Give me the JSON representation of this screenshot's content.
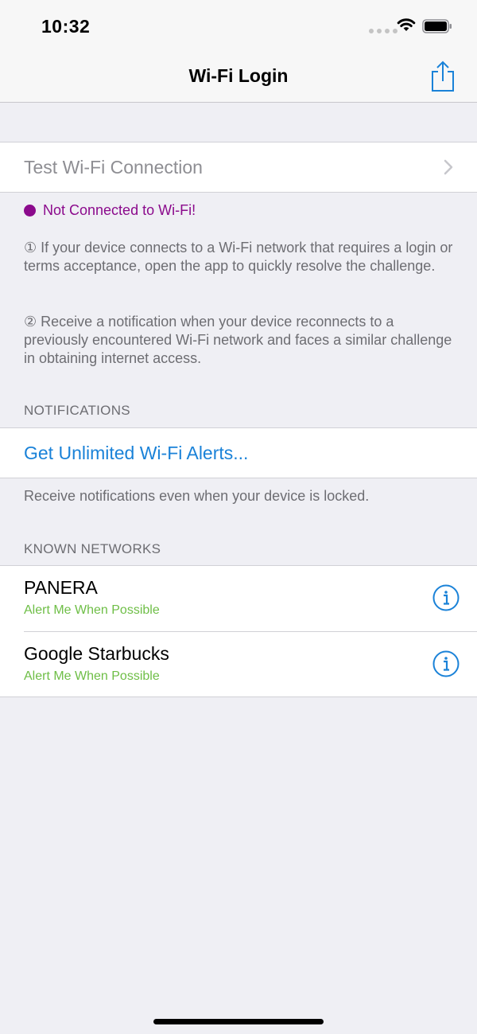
{
  "status_bar": {
    "time": "10:32"
  },
  "nav": {
    "title": "Wi-Fi Login"
  },
  "test_connection": {
    "label": "Test Wi-Fi Connection"
  },
  "connection_status": {
    "text": "Not Connected to Wi-Fi!",
    "color": "#8b0a8c"
  },
  "info": {
    "para1": "① If your device connects to a Wi-Fi network that requires a login or terms acceptance, open the app to quickly resolve the challenge.",
    "para2": "② Receive a notification when your device reconnects to a previously encountered Wi-Fi network and faces a similar challenge in obtaining internet access."
  },
  "notifications": {
    "header": "NOTIFICATIONS",
    "alerts_label": "Get Unlimited Wi-Fi Alerts...",
    "footer": "Receive notifications even when your device is locked."
  },
  "known_networks": {
    "header": "KNOWN NETWORKS",
    "items": [
      {
        "name": "PANERA",
        "subtitle": "Alert Me When Possible"
      },
      {
        "name": "Google Starbucks",
        "subtitle": "Alert Me When Possible"
      }
    ]
  },
  "colors": {
    "accent": "#1a82d8",
    "subtitle_green": "#6ebe46",
    "background": "#efeff4"
  },
  "icons": [
    "wifi-icon",
    "battery-icon",
    "share-icon",
    "chevron-right-icon",
    "info-icon"
  ]
}
